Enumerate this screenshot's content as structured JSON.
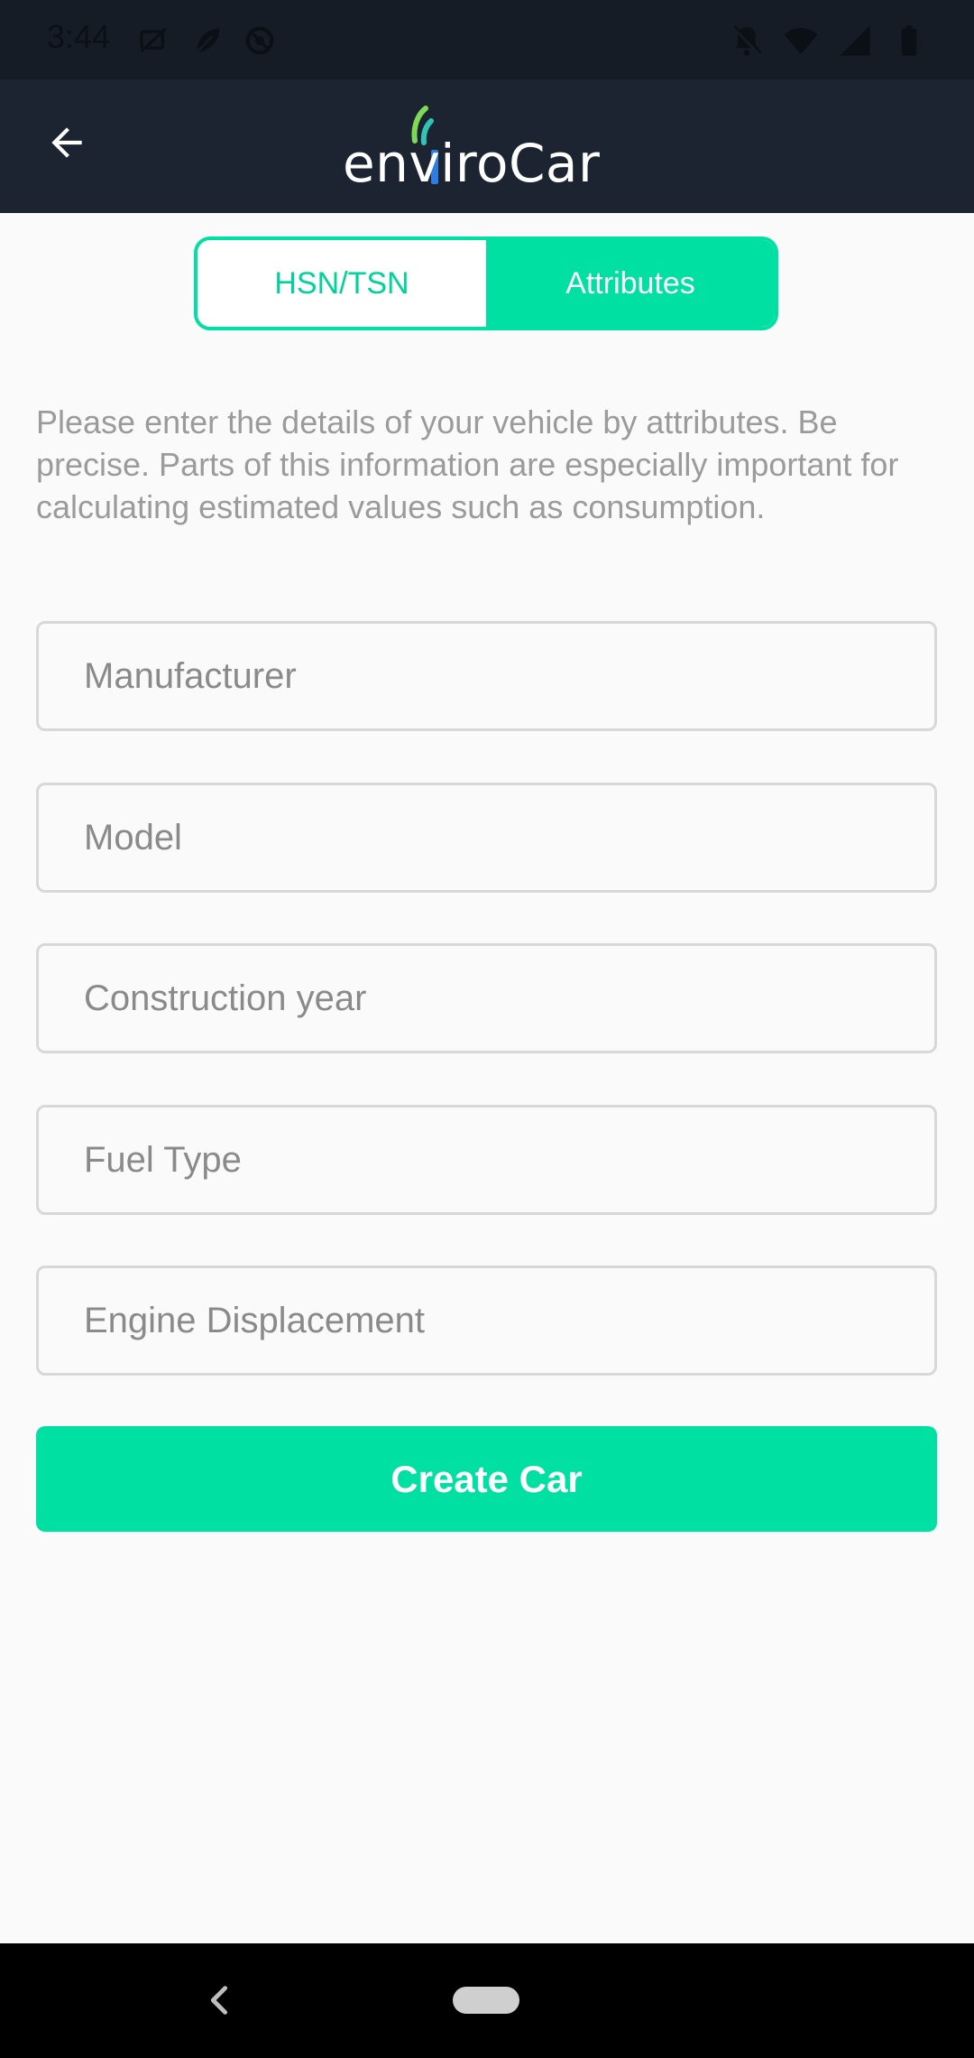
{
  "status_bar": {
    "time": "3:44",
    "left_icons": [
      "photo-blocked-icon",
      "leaf-icon",
      "sync-icon"
    ],
    "right_icons": [
      "notifications-off-icon",
      "wifi-icon",
      "signal-icon",
      "battery-icon"
    ]
  },
  "app_bar": {
    "back_icon": "arrow-back-icon",
    "logo_text": "enviroCar",
    "colors": {
      "background": "#1b2430",
      "logo_arc_green": "#7ed957",
      "logo_arc_teal": "#2ec4b6",
      "logo_bar_blue": "#2f7de1"
    }
  },
  "tabs": [
    {
      "label": "HSN/TSN",
      "active": false
    },
    {
      "label": "Attributes",
      "active": true
    }
  ],
  "description": "Please enter the details of your vehicle by attributes. Be precise. Parts of this information are especially important for calculating estimated values such as consumption.",
  "form": {
    "manufacturer": {
      "placeholder": "Manufacturer",
      "value": ""
    },
    "model": {
      "placeholder": "Model",
      "value": ""
    },
    "construction_year": {
      "placeholder": "Construction year",
      "value": ""
    },
    "fuel_type": {
      "placeholder": "Fuel Type",
      "value": ""
    },
    "engine_displacement": {
      "placeholder": "Engine Displacement",
      "value": ""
    }
  },
  "create_button": {
    "label": "Create Car"
  },
  "theme": {
    "accent": "#00e0a2",
    "text_muted": "#9b9b9b",
    "border": "#d8d8d8"
  },
  "nav_bar": {
    "back_icon": "chevron-left-icon",
    "home_icon": "home-pill-icon"
  }
}
